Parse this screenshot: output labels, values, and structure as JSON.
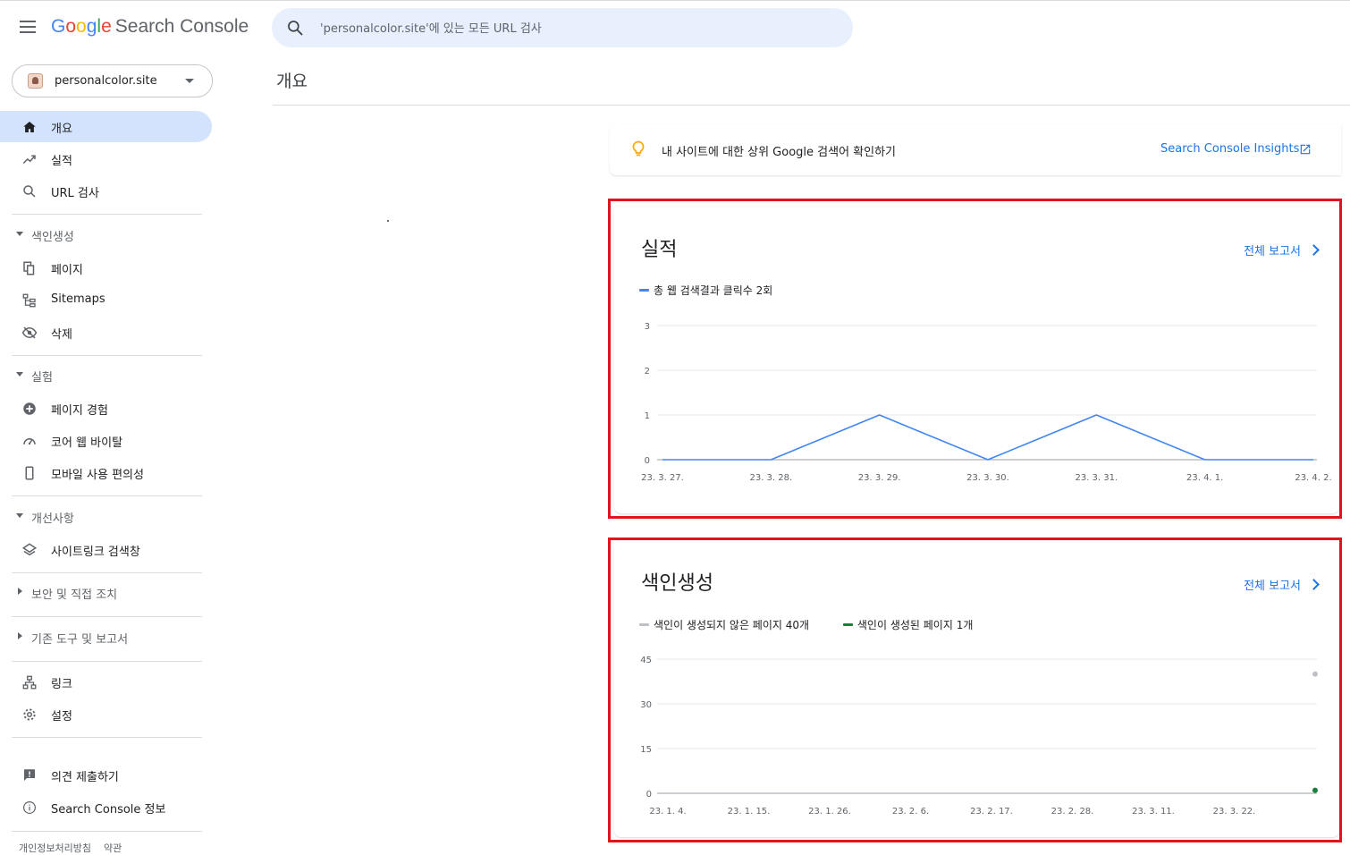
{
  "header": {
    "logo_letters": [
      "G",
      "o",
      "o",
      "g",
      "l",
      "e"
    ],
    "logo_product": "Search Console",
    "search_placeholder": "'personalcolor.site'에 있는 모든 URL 검사"
  },
  "property": {
    "name": "personalcolor.site"
  },
  "page_title": "개요",
  "sidebar": {
    "items_top": [
      {
        "label": "개요",
        "icon": "home-icon",
        "active": true
      },
      {
        "label": "실적",
        "icon": "trending-up-icon"
      },
      {
        "label": "URL 검사",
        "icon": "search-icon"
      }
    ],
    "section_index": {
      "label": "색인생성",
      "items": [
        {
          "label": "페이지",
          "icon": "pages-icon"
        },
        {
          "label": "Sitemaps",
          "icon": "sitemap-icon"
        },
        {
          "label": "삭제",
          "icon": "eye-off-icon"
        }
      ]
    },
    "section_experience": {
      "label": "실험",
      "items": [
        {
          "label": "페이지 경험",
          "icon": "plus-circle-icon"
        },
        {
          "label": "코어 웹 바이탈",
          "icon": "speed-gauge-icon"
        },
        {
          "label": "모바일 사용 편의성",
          "icon": "phone-icon"
        }
      ]
    },
    "section_enhancements": {
      "label": "개선사항",
      "items": [
        {
          "label": "사이트링크 검색창",
          "icon": "layers-icon"
        }
      ]
    },
    "section_security": {
      "label": "보안 및 직접 조치"
    },
    "section_legacy": {
      "label": "기존 도구 및 보고서"
    },
    "items_bottom": [
      {
        "label": "링크",
        "icon": "links-icon"
      },
      {
        "label": "설정",
        "icon": "gear-icon"
      }
    ],
    "items_footer": [
      {
        "label": "의견 제출하기",
        "icon": "feedback-icon"
      },
      {
        "label": "Search Console 정보",
        "icon": "info-icon"
      }
    ],
    "footer_links": [
      "개인정보처리방침",
      "약관"
    ]
  },
  "insights": {
    "text": "내 사이트에 대한 상위 Google 검색어 확인하기",
    "link": "Search Console Insights",
    "icon": "lightbulb-icon"
  },
  "performance_card": {
    "title": "실적",
    "full_report": "전체 보고서",
    "legend": "총 웹 검색결과 클릭수 2회",
    "color": "#4285f4"
  },
  "indexing_card": {
    "title": "색인생성",
    "full_report": "전체 보고서",
    "legend_not_indexed": "색인이 생성되지 않은 페이지 40개",
    "legend_indexed": "색인이 생성된 페이지 1개",
    "color_not_indexed": "#bdc1c6",
    "color_indexed": "#188038"
  },
  "chart_data": [
    {
      "type": "line",
      "title": "실적",
      "x": [
        "23. 3. 27.",
        "23. 3. 28.",
        "23. 3. 29.",
        "23. 3. 30.",
        "23. 3. 31.",
        "23. 4. 1.",
        "23. 4. 2."
      ],
      "series": [
        {
          "name": "총 웹 검색결과 클릭수 2회",
          "values": [
            0,
            0,
            1,
            0,
            1,
            0,
            0
          ],
          "color": "#4285f4"
        }
      ],
      "yticks": [
        0,
        1,
        2,
        3
      ],
      "ylim": [
        0,
        3
      ],
      "grid": true
    },
    {
      "type": "scatter",
      "title": "색인생성",
      "x": [
        "23. 1. 4.",
        "23. 1. 15.",
        "23. 1. 26.",
        "23. 2. 6.",
        "23. 2. 17.",
        "23. 2. 28.",
        "23. 3. 11.",
        "23. 3. 22."
      ],
      "series": [
        {
          "name": "색인이 생성되지 않은 페이지 40개",
          "points": [
            {
              "x": "23. 4. 2.",
              "y": 40
            }
          ],
          "color": "#bdc1c6"
        },
        {
          "name": "색인이 생성된 페이지 1개",
          "points": [
            {
              "x": "23. 4. 2.",
              "y": 1
            }
          ],
          "color": "#188038"
        }
      ],
      "yticks": [
        0,
        15,
        30,
        45
      ],
      "ylim": [
        0,
        45
      ],
      "grid": true
    }
  ]
}
